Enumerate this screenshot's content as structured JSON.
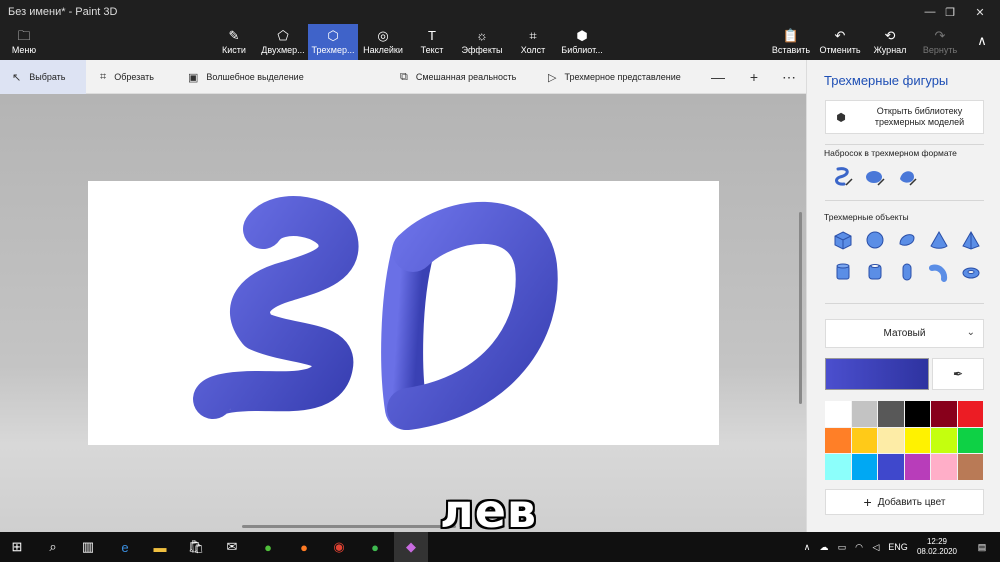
{
  "window": {
    "title": "Без имени* - Paint 3D",
    "minimize_glyph": "—",
    "maximize_glyph": "❐",
    "close_glyph": "✕"
  },
  "ribbon": {
    "menu": {
      "label": "Меню",
      "icon": "folder-icon"
    },
    "tabs": [
      {
        "label": "Кисти",
        "icon": "brush-icon"
      },
      {
        "label": "Двухмер...",
        "icon": "2d-shapes-icon"
      },
      {
        "label": "Трехмер...",
        "icon": "3d-shapes-icon",
        "active": true
      },
      {
        "label": "Наклейки",
        "icon": "stickers-icon"
      },
      {
        "label": "Текст",
        "icon": "text-icon"
      },
      {
        "label": "Эффекты",
        "icon": "effects-icon"
      },
      {
        "label": "Холст",
        "icon": "canvas-icon"
      },
      {
        "label": "Библиот...",
        "icon": "library-icon"
      }
    ],
    "actions": [
      {
        "label": "Вставить",
        "icon": "paste-icon"
      },
      {
        "label": "Отменить",
        "icon": "undo-icon"
      },
      {
        "label": "Журнал",
        "icon": "history-icon"
      },
      {
        "label": "Вернуть",
        "icon": "redo-icon",
        "disabled": true
      }
    ],
    "collapse_glyph": "∧"
  },
  "toolbar": {
    "select": "Выбрать",
    "crop": "Обрезать",
    "magic_select": "Волшебное выделение",
    "mixed_reality": "Смешанная реальность",
    "view_3d": "Трехмерное представление",
    "zoom_out": "—",
    "zoom_in": "+",
    "more": "⋯"
  },
  "canvas": {
    "art_color": "#5359d8",
    "art_shade": "#3037a6"
  },
  "caption": "лев",
  "panel": {
    "title": "Трехмерные фигуры",
    "library_button_line1": "Открыть библиотеку",
    "library_button_line2": "трехмерных моделей",
    "sketch_label": "Набросок в трехмерном формате",
    "sketch_tools": [
      "sharp-edge-doodle-icon",
      "soft-edge-doodle-icon",
      "tube-doodle-icon"
    ],
    "objects_label": "Трехмерные объекты",
    "objects_row1": [
      "cube-icon",
      "sphere-icon",
      "hemisphere-icon",
      "cone-icon",
      "pyramid-icon"
    ],
    "objects_row2": [
      "cylinder-icon",
      "tube-icon",
      "capsule-icon",
      "curved-tube-icon",
      "torus-icon"
    ],
    "material": "Матовый",
    "current_color": "#4b4fce",
    "palette": [
      "#ffffff",
      "#c3c3c3",
      "#585858",
      "#000000",
      "#88001b",
      "#ec1c24",
      "#ff7f27",
      "#ffca18",
      "#fdeca6",
      "#fff200",
      "#c4ff0e",
      "#0ed145",
      "#8cfffb",
      "#00a8f3",
      "#3f48cc",
      "#b83dba",
      "#ffaec8",
      "#b97a56"
    ],
    "add_color": "Добавить цвет"
  },
  "taskbar": {
    "apps": [
      "windows-start-icon",
      "search-icon",
      "task-view-icon",
      "edge-icon",
      "file-explorer-icon",
      "store-icon",
      "mail-icon",
      "utorrent-icon",
      "firefox-icon",
      "chrome-icon",
      "green-app-icon",
      "paint3d-icon"
    ],
    "lang": "ENG",
    "time": "12:29",
    "date": "08.02.2020"
  }
}
